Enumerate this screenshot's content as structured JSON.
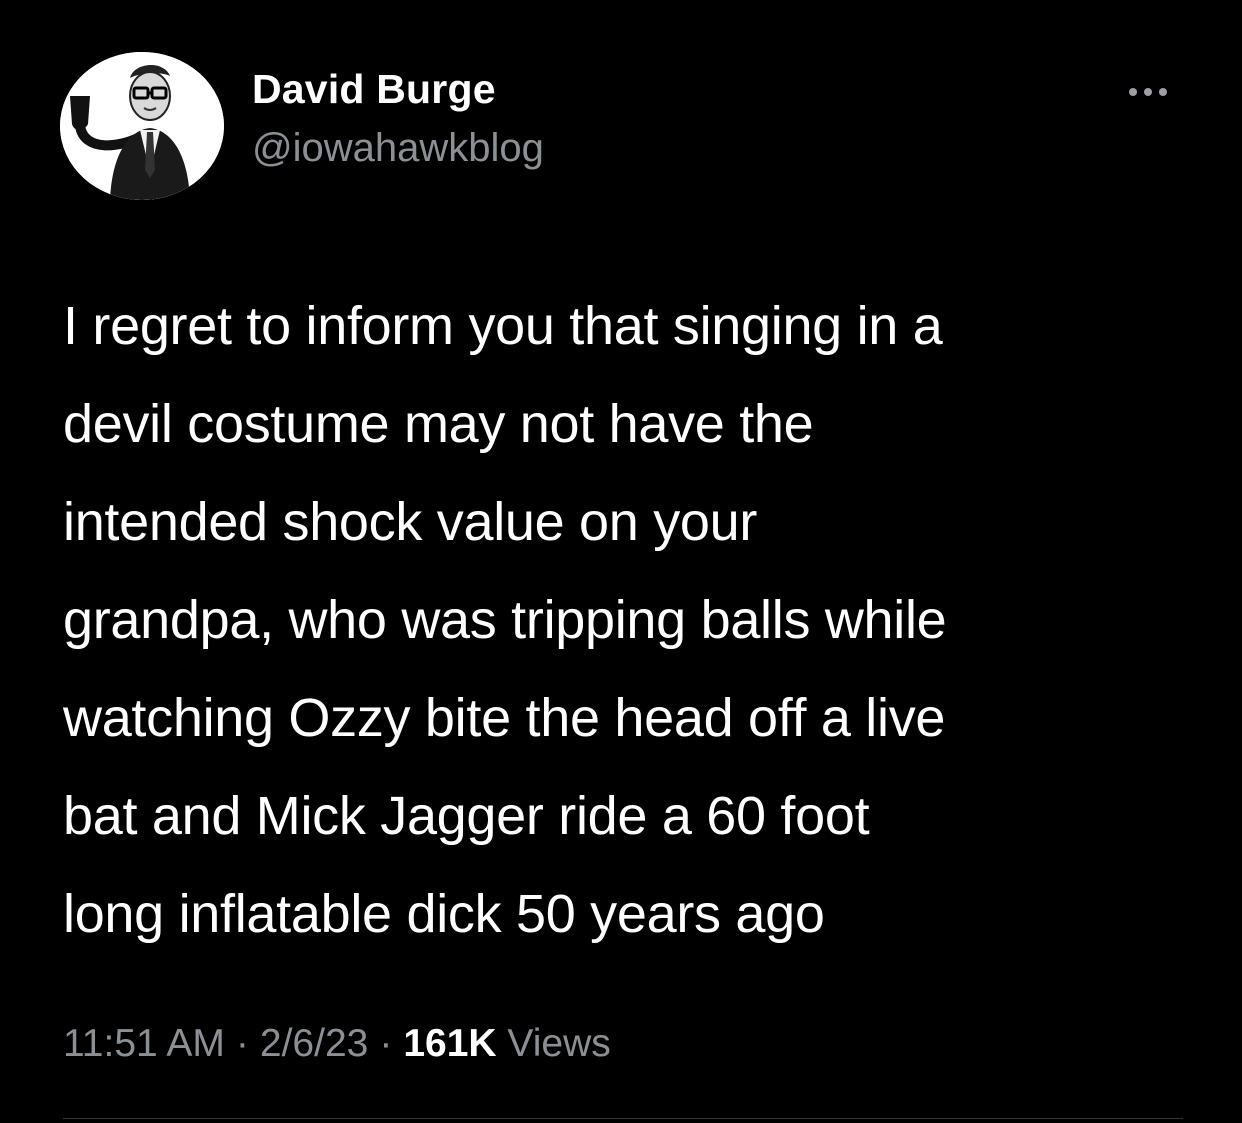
{
  "author": {
    "display_name": "David Burge",
    "handle": "@iowahawkblog",
    "avatar_icon": "profile-photo-man-with-pipe"
  },
  "more_icon": "more-horizontal-icon",
  "tweet": {
    "lines": [
      "I regret to inform you that singing in a",
      "devil costume may not have the",
      "intended shock value on your",
      "grandpa, who was tripping balls while",
      "watching Ozzy bite the head off a live",
      "bat and Mick Jagger ride a 60 foot",
      "long inflatable dick 50 years ago"
    ]
  },
  "meta": {
    "time": "11:51 AM",
    "separator": "·",
    "date": "2/6/23",
    "views_count": "161K",
    "views_label": "Views"
  },
  "colors": {
    "background": "#000000",
    "primary_text": "#ffffff",
    "secondary_text": "#8b9096",
    "divider": "#2f3336"
  }
}
